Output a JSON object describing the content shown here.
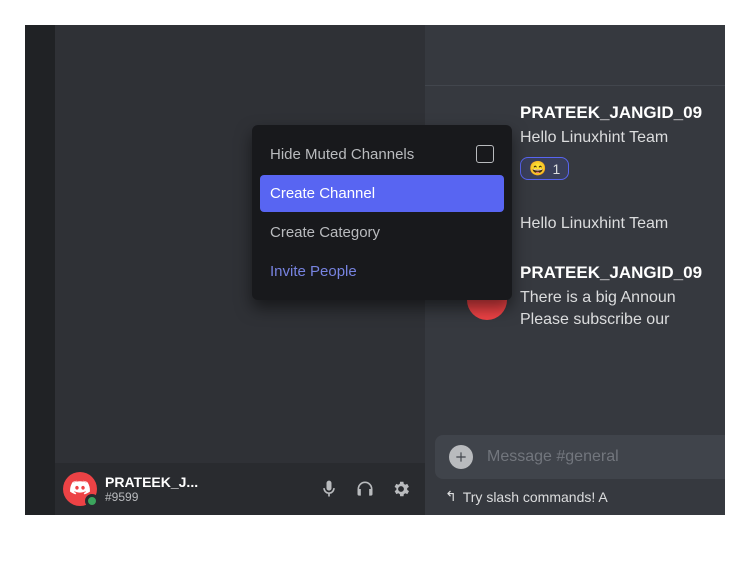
{
  "user": {
    "display_name": "PRATEEK_J...",
    "tag": "#9599"
  },
  "context_menu": {
    "hide_muted": "Hide Muted Channels",
    "create_channel": "Create Channel",
    "create_category": "Create Category",
    "invite_people": "Invite People"
  },
  "messages": {
    "m1_author": "PRATEEK_JANGID_09",
    "m1_body": "Hello Linuxhint Team",
    "m1_reaction_emoji": "😄",
    "m1_reaction_count": "1",
    "m2_body": "Hello Linuxhint Team",
    "m3_author": "PRATEEK_JANGID_09",
    "m3_body_l1": "There is a big Announ",
    "m3_body_l2": "Please subscribe our"
  },
  "composer": {
    "placeholder": "Message #general"
  },
  "hint": "Try slash commands! A"
}
